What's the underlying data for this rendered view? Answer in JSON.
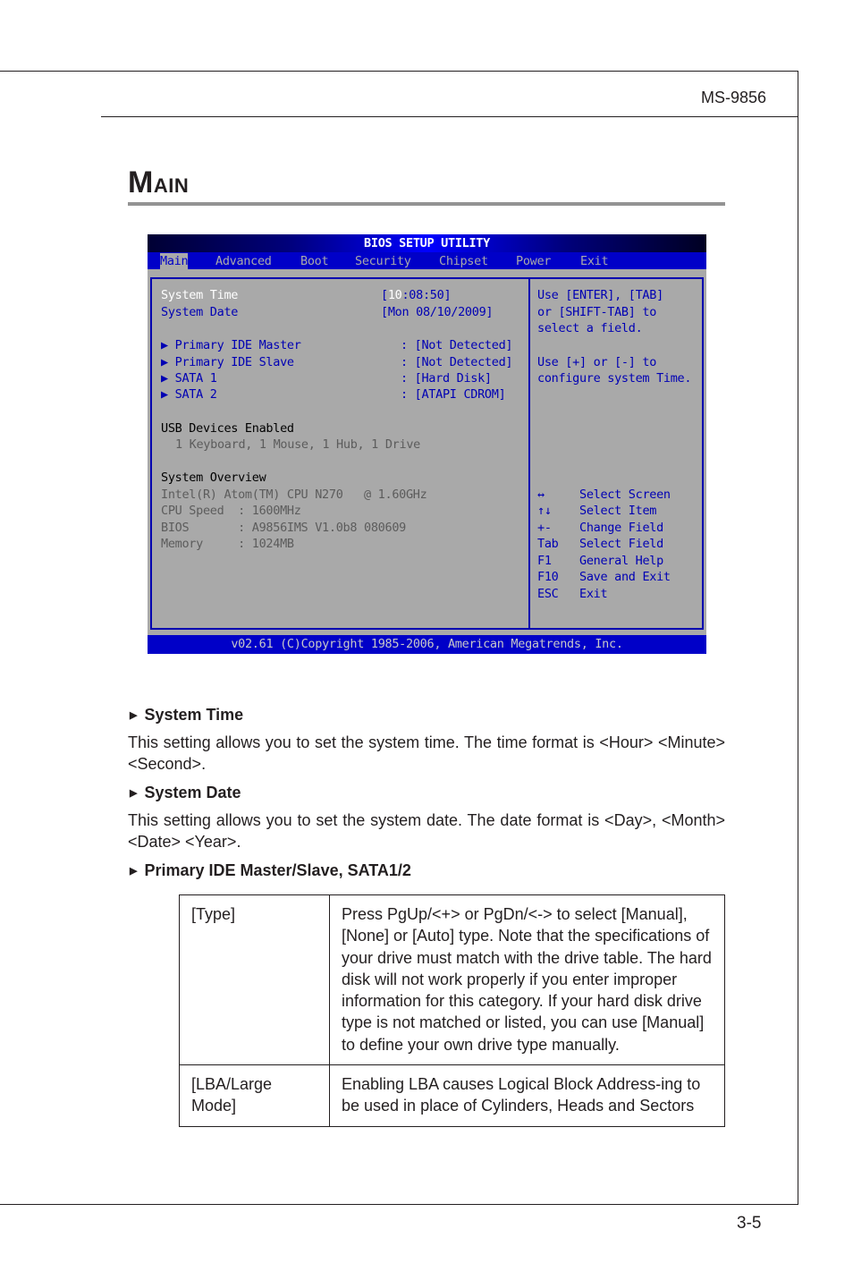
{
  "header": {
    "model": "MS-9856"
  },
  "section": {
    "title_first": "M",
    "title_rest": "AIN"
  },
  "bios": {
    "title": "BIOS SETUP UTILITY",
    "menu": [
      {
        "label": "Main",
        "active": true
      },
      {
        "label": "Advanced"
      },
      {
        "label": "Boot"
      },
      {
        "label": "Security"
      },
      {
        "label": "Chipset"
      },
      {
        "label": "Power"
      },
      {
        "label": "Exit"
      }
    ],
    "system_time": {
      "label": "System Time",
      "open": "[",
      "hour": "10",
      "rest": ":08:50]"
    },
    "system_date": {
      "label": "System Date",
      "value": "[Mon 08/10/2009]"
    },
    "drives": [
      {
        "label": "Primary IDE Master",
        "value": ": [Not Detected]"
      },
      {
        "label": "Primary IDE Slave",
        "value": ": [Not Detected]"
      },
      {
        "label": "SATA 1",
        "value": ": [Hard Disk]"
      },
      {
        "label": "SATA 2",
        "value": ": [ATAPI CDROM]"
      }
    ],
    "usb": {
      "heading": "USB Devices Enabled",
      "value": "1 Keyboard, 1 Mouse, 1 Hub, 1 Drive"
    },
    "overview": {
      "heading": "System Overview",
      "cpu": "Intel(R) Atom(TM) CPU N270   @ 1.60GHz",
      "lines": [
        "CPU Speed  : 1600MHz",
        "BIOS       : A9856IMS V1.0b8 080609",
        "Memory     : 1024MB"
      ]
    },
    "help": [
      "Use [ENTER], [TAB]",
      "or [SHIFT-TAB] to",
      "select a field.",
      "",
      "Use [+] or [-] to",
      "configure system Time."
    ],
    "keys": [
      {
        "key": "↔",
        "action": "Select Screen"
      },
      {
        "key": "↑↓",
        "action": "Select Item"
      },
      {
        "key": "+-",
        "action": "Change Field"
      },
      {
        "key": "Tab",
        "action": "Select Field"
      },
      {
        "key": "F1",
        "action": "General Help"
      },
      {
        "key": "F10",
        "action": "Save and Exit"
      },
      {
        "key": "ESC",
        "action": "Exit"
      }
    ],
    "footer": "v02.61 (C)Copyright 1985-2006, American Megatrends, Inc.",
    "colors": {
      "background": "#a9a9a9",
      "menu_bar": "#0000c8",
      "text_blue": "#0000b4"
    }
  },
  "body": {
    "items": [
      {
        "heading": "System Time",
        "text": "This setting allows you to set the system time. The time format is <Hour> <Minute> <Second>."
      },
      {
        "heading": "System Date",
        "text": "This setting allows you to set the system date. The date format is <Day>, <Month> <Date> <Year>."
      },
      {
        "heading": "Primary IDE Master/Slave, SATA1/2"
      }
    ],
    "table": [
      {
        "key": "[Type]",
        "desc": "Press PgUp/<+> or PgDn/<-> to select [Manual], [None] or [Auto] type. Note that the specifications of your drive must match with the drive table. The hard disk will not work properly if you enter improper information for this category. If your hard disk drive type is not matched or listed, you can use [Manual] to define your own drive type manually."
      },
      {
        "key": "[LBA/Large Mode]",
        "desc": "Enabling LBA causes Logical Block Address-ing to be used in place of Cylinders, Heads and Sectors"
      }
    ]
  },
  "footer": {
    "page_number": "3-5"
  }
}
